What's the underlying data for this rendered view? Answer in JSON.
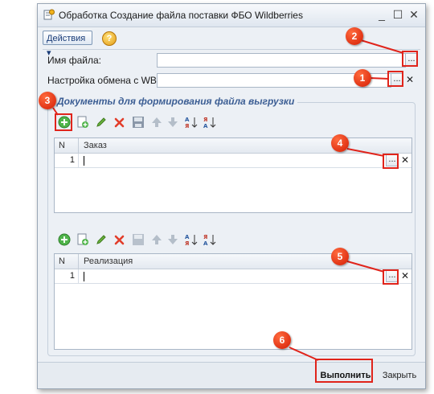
{
  "window": {
    "title": "Обработка  Создание файла поставки ФБО Wildberries",
    "minimize_glyph": "_",
    "maximize_glyph": "☐",
    "close_glyph": "✕"
  },
  "toolbar": {
    "actions_label": "Действия ▾",
    "help_label": "?"
  },
  "fields": {
    "filename_label": "Имя файла:",
    "filename_value": "",
    "wb_settings_label": "Настройка обмена с WB:",
    "wb_settings_value": "",
    "dots": "...",
    "clear": "✕"
  },
  "group": {
    "title": "Документы для формирования файла выгрузки"
  },
  "orders_grid": {
    "col_n": "N",
    "col_main": "Заказ",
    "rows": [
      {
        "n": "1",
        "value": ""
      }
    ]
  },
  "sales_grid": {
    "col_n": "N",
    "col_main": "Реализация",
    "rows": [
      {
        "n": "1",
        "value": ""
      }
    ]
  },
  "callouts": {
    "c1": "1",
    "c2": "2",
    "c3": "3",
    "c4": "4",
    "c5": "5",
    "c6": "6"
  },
  "footer": {
    "run_label": "Выполнить",
    "close_label": "Закрыть"
  },
  "colors": {
    "callout": "#d41c04",
    "highlight": "#e0241b",
    "group_title": "#3c5e94"
  },
  "icons": [
    "add-icon",
    "copy-icon",
    "edit-icon",
    "delete-icon",
    "save-icon",
    "move-up-icon",
    "move-down-icon",
    "sort-asc-icon",
    "sort-desc-icon"
  ]
}
